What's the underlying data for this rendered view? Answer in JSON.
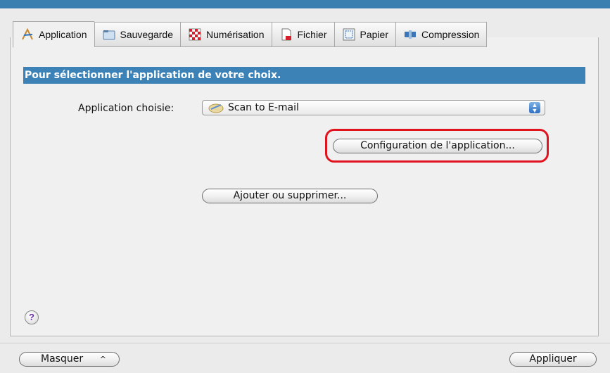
{
  "tabs": [
    {
      "label": "Application",
      "icon": "application-icon",
      "active": true
    },
    {
      "label": "Sauvegarde",
      "icon": "folder-icon",
      "active": false
    },
    {
      "label": "Numérisation",
      "icon": "checker-icon",
      "active": false
    },
    {
      "label": "Fichier",
      "icon": "document-icon",
      "active": false
    },
    {
      "label": "Papier",
      "icon": "paper-icon",
      "active": false
    },
    {
      "label": "Compression",
      "icon": "compression-icon",
      "active": false
    }
  ],
  "banner": {
    "text": "Pour sélectionner l'application de votre choix."
  },
  "app_select": {
    "label": "Application choisie:",
    "value": "Scan to E-mail",
    "icon": "email-app-icon"
  },
  "buttons": {
    "config": "Configuration de l'application...",
    "add_remove": "Ajouter ou supprimer...",
    "hide": "Masquer",
    "apply": "Appliquer"
  },
  "help": {
    "glyph": "?"
  },
  "colors": {
    "banner": "#3d82b7",
    "highlight": "#e0131f",
    "titlebar": "#3b7fb0"
  }
}
